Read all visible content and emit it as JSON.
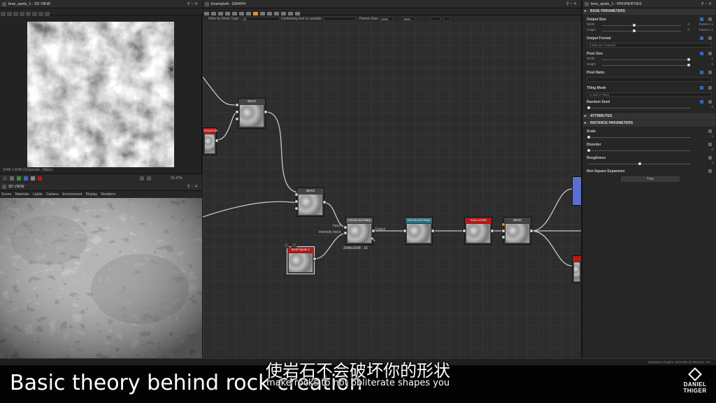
{
  "view2d": {
    "title": "bnw_spots_1 - 2D VIEW",
    "info": "2048 x 2048 (Grayscale, 16bpc)",
    "zoom": "25.47%"
  },
  "view3d": {
    "title": "3D VIEW",
    "menu": [
      "Scene",
      "Materials",
      "Lights",
      "Camera",
      "Environment",
      "Display",
      "Renderer"
    ]
  },
  "graph": {
    "title": "ExampleA - GRAPH",
    "filter_label": "Filter by Node Type",
    "filter_value": "All",
    "containing_label": "Containing text or variable",
    "parent_size_label": "Parent Size:",
    "parent_size_a": "2048",
    "parent_size_b": "2048",
    "nodes": [
      {
        "id": "blend1",
        "label": "Blend"
      },
      {
        "id": "grayscale",
        "label": "Grayscale"
      },
      {
        "id": "blend2",
        "label": "Blend"
      },
      {
        "id": "dwarp1",
        "label": "Directional Warp"
      },
      {
        "id": "dwarp2",
        "label": "Directional Warp"
      },
      {
        "id": "autolevels",
        "label": "Auto Levels"
      },
      {
        "id": "blend3",
        "label": "Blend"
      },
      {
        "id": "bnwspots",
        "label": "BnW Spots 1"
      }
    ],
    "size_label": "2048x2048 - 16",
    "pin_labels": {
      "input": "Input",
      "intensity": "Intensity Input",
      "output": "Output"
    }
  },
  "properties": {
    "title": "bnw_spots_1 - PROPERTIES",
    "sections": {
      "base": "BASE PARAMETERS",
      "attributes": "ATTRIBUTES",
      "instance": "INSTANCE PARAMETERS"
    },
    "output_size": {
      "label": "Output Size",
      "width_label": "Width",
      "height_label": "Height",
      "width_val": "0",
      "height_val": "0",
      "width_rel": "Parent x 1",
      "height_rel": "Parent x 1"
    },
    "output_format": {
      "label": "Output Format",
      "value": "8 Bits per Channel"
    },
    "pixel_size": {
      "label": "Pixel Size",
      "width_label": "Width",
      "height_label": "Height",
      "width_val": "1",
      "height_val": "1"
    },
    "pixel_ratio": {
      "label": "Pixel Ratio"
    },
    "tiling_mode": {
      "label": "Tiling Mode",
      "value": "H and V Tiling"
    },
    "random_seed": {
      "label": "Random Seed",
      "value": "0"
    },
    "scale": {
      "label": "Scale",
      "value": "1"
    },
    "disorder": {
      "label": "Disorder",
      "value": "0"
    },
    "roughness": {
      "label": "Roughness",
      "value": "1"
    },
    "non_square": {
      "label": "Non Square Expansion",
      "value": "True"
    }
  },
  "status": {
    "engine": "Substance Engine: Direct3D 10   Memory: 1%"
  },
  "overlay": {
    "topic": "Basic theory behind rock creation",
    "subtitle_cn": "使岩石不会破坏你的形状",
    "subtitle_en": "make rocks to not obliterate shapes you",
    "logo_line1": "DANIEL",
    "logo_line2": "THIGER"
  },
  "colors": {
    "accent_blue": "#3b66b0",
    "node_red": "#b31a1a",
    "node_teal": "#2e6b78",
    "panel": "#262626"
  }
}
